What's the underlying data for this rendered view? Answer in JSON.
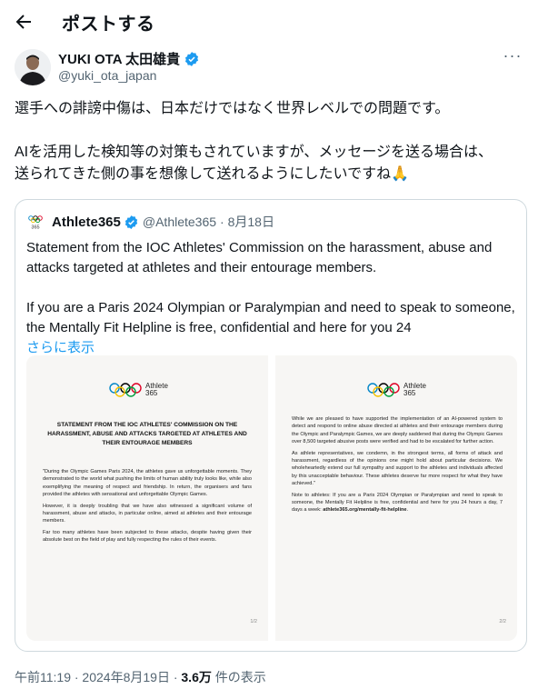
{
  "header": {
    "title": "ポストする",
    "back_icon": "back-arrow-icon"
  },
  "author": {
    "name": "YUKI OTA 太田雄貴",
    "handle": "@yuki_ota_japan",
    "verified_color": "#1d9bf0"
  },
  "tweet": {
    "line1": "選手への誹謗中傷は、日本だけではなく世界レベルでの問題です。",
    "line2": "AIを活用した検知等の対策もされていますが、メッセージを送る場合は、",
    "line3": "送られてきた側の事を想像して送れるようにしたいですね🙏"
  },
  "quote": {
    "name": "Athlete365",
    "handle": "@Athlete365",
    "date": "· 8月18日",
    "text_line1": "Statement from the IOC Athletes' Commission on the harassment, abuse and",
    "text_line2": "attacks targeted at athletes and their entourage members.",
    "text_line3": "If you are a Paris 2024 Olympian or Paralympian and need to speak to someone,",
    "text_line4": "the Mentally Fit Helpline is free, confidential and here for you 24",
    "show_more": "さらに表示",
    "logo_text": "365",
    "doc1": {
      "brand_line1": "Athlete",
      "brand_line2": "365",
      "heading": "STATEMENT FROM THE IOC ATHLETES' COMMISSION ON THE HARASSMENT, ABUSE AND ATTACKS TARGETED AT ATHLETES AND THEIR ENTOURAGE MEMBERS",
      "p1": "\"During the Olympic Games Paris 2024, the athletes gave us unforgettable moments. They demonstrated to the world what pushing the limits of human ability truly looks like, while also exemplifying the meaning of respect and friendship. In return, the organisers and fans provided the athletes with sensational and unforgettable Olympic Games.",
      "p2": "However, it is deeply troubling that we have also witnessed a significant volume of harassment, abuse and attacks, in particular online, aimed at athletes and their entourage members.",
      "p3": "Far too many athletes have been subjected to these attacks, despite having given their absolute best on the field of play and fully respecting the rules of their events.",
      "page": "1/2"
    },
    "doc2": {
      "brand_line1": "Athlete",
      "brand_line2": "365",
      "p1": "While we are pleased to have supported the implementation of an AI-powered system to detect and respond to online abuse directed at athletes and their entourage members during the Olympic and Paralympic Games, we are deeply saddened that during the Olympic Games over 8,500 targeted abusive posts were verified and had to be escalated for further action.",
      "p2": "As athlete representatives, we condemn, in the strongest terms, all forms of attack and harassment, regardless of the opinions one might hold about particular decisions. We wholeheartedly extend our full sympathy and support to the athletes and individuals affected by this unacceptable behaviour. These athletes deserve far more respect for what they have achieved.\"",
      "p3": "Note to athletes: If you are a Paris 2024 Olympian or Paralympian and need to speak to someone, the Mentally Fit Helpline is free, confidential and here for you 24 hours a day, 7 days a week:",
      "p3_link": "athlete365.org/mentally-fit-helpline",
      "p3_end": ".",
      "page": "2/2"
    }
  },
  "meta": {
    "time": "午前11:19 · 2024年8月19日 · ",
    "views": "3.6万",
    "views_suffix": " 件の表示"
  }
}
